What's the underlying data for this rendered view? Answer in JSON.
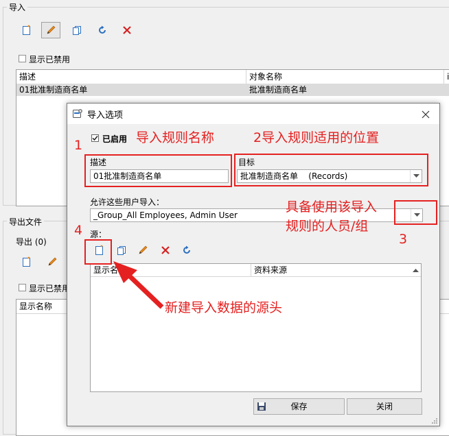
{
  "background": {
    "import_section": {
      "title": "导入",
      "show_disabled_label": "显示已禁用",
      "columns": [
        "描述",
        "对象名称",
        "i"
      ],
      "rows": [
        {
          "description": "01批准制造商名单",
          "object_name": "批准制造商名单"
        }
      ]
    },
    "export_section": {
      "title": "导出文件",
      "export_count_label": "导出 (0)",
      "show_disabled_label": "显示已禁用",
      "columns": [
        "显示名称"
      ]
    }
  },
  "dialog": {
    "title": "导入选项",
    "enabled_label": "已启用",
    "description": {
      "label": "描述",
      "value": "01批准制造商名单"
    },
    "target": {
      "label": "目标",
      "value": "批准制造商名单    (Records)"
    },
    "allow_users": {
      "label": "允许这些用户导入：",
      "value": "_Group_All Employees, Admin User"
    },
    "sources": {
      "label": "源：",
      "columns": [
        "显示名称",
        "资料来源"
      ]
    },
    "save_label": "保存",
    "close_label": "关闭"
  },
  "annotations": {
    "n1": "1",
    "n1_text": "导入规则名称",
    "n2_text": "2导入规则适用的位置",
    "n3": "3",
    "n3_text_line1": "具备使用该导入",
    "n3_text_line2": "规则的人员/组",
    "n4": "4",
    "arrow_text": "新建导入数据的源头"
  },
  "colors": {
    "annotation_red": "#e52020",
    "toolbar_blue": "#2a6ebd",
    "delete_red": "#d42020",
    "pencil_orange": "#e8891a"
  }
}
